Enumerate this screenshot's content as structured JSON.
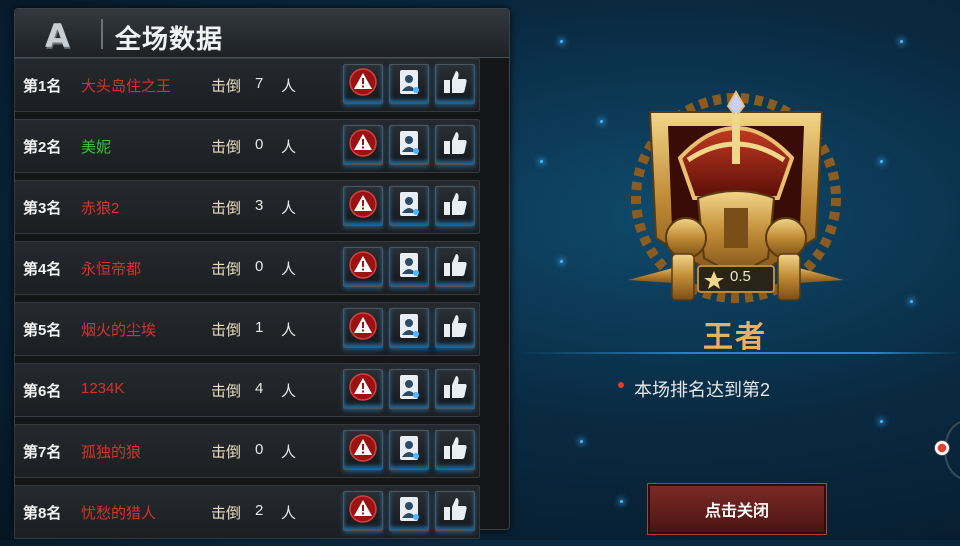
{
  "panel": {
    "badge_letter": "A",
    "title": "全场数据"
  },
  "labels": {
    "kill": "击倒",
    "person": "人"
  },
  "players": [
    {
      "rank": "第1名",
      "name": "大头岛住之王",
      "kills": "7",
      "name_color": "#d8322c"
    },
    {
      "rank": "第2名",
      "name": "美妮",
      "kills": "0",
      "name_color": "#36c23a"
    },
    {
      "rank": "第3名",
      "name": "赤狼2",
      "kills": "3",
      "name_color": "#d8322c"
    },
    {
      "rank": "第4名",
      "name": "永恒帝都",
      "kills": "0",
      "name_color": "#d8322c"
    },
    {
      "rank": "第5名",
      "name": "烟火的尘埃",
      "kills": "1",
      "name_color": "#d8322c"
    },
    {
      "rank": "第6名",
      "name": "1234K",
      "kills": "4",
      "name_color": "#d8322c"
    },
    {
      "rank": "第7名",
      "name": "孤独的狼",
      "kills": "0",
      "name_color": "#d8322c"
    },
    {
      "rank": "第8名",
      "name": "忧愁的猎人",
      "kills": "2",
      "name_color": "#d8322c"
    }
  ],
  "icons": {
    "report": "warning-icon",
    "profile": "profile-card-icon",
    "like": "thumbs-up-icon"
  },
  "result": {
    "badge_score": "0.5",
    "rank_title": "王者",
    "info": "本场排名达到第2",
    "close_label": "点击关闭"
  },
  "colors": {
    "rank_title": "#e8b060",
    "accent_blue": "#2a86c2",
    "close_button": "#6b2420"
  }
}
